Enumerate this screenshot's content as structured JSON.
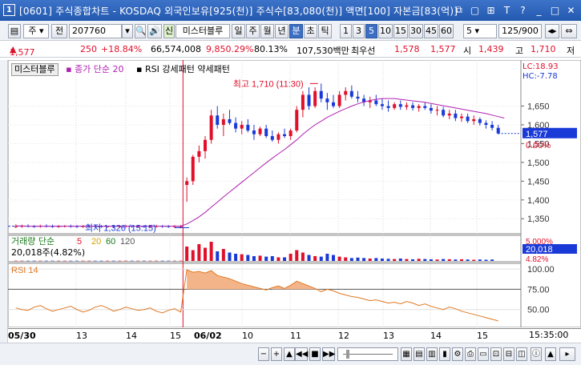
{
  "window": {
    "icon": "1",
    "title": "[0601] 주식종합차트 - KOSDAQ 외국인보유[925(천)] 주식수[83,080(천)] 액면[100] 자본금[83(억)]",
    "buttons": [
      "restore-icon",
      "copy-icon",
      "pin-icon",
      "font-icon",
      "help-icon",
      "minimize-icon",
      "maximize-icon",
      "close-icon"
    ],
    "button_glyphs": [
      "⧉",
      "▢",
      "⊞",
      "T",
      "?",
      "_",
      "□",
      "✕"
    ]
  },
  "toolbar": {
    "market": "주",
    "prefix": "전",
    "code": "207760",
    "name_label": "미스터블루",
    "name_prefix": "신",
    "periods": [
      "일",
      "주",
      "월",
      "년",
      "분",
      "초",
      "틱"
    ],
    "active_period": "분",
    "intervals": [
      "1",
      "3",
      "5",
      "10",
      "15",
      "30",
      "45",
      "60"
    ],
    "active_interval": "5",
    "count_value": "5",
    "range": "125/900"
  },
  "quote": {
    "price": "1,577",
    "change": "250",
    "change_pct": "+18.84%",
    "volume": "66,574,008",
    "volume_pct": "9,850.29%",
    "turnover_pct": "80.13%",
    "amount": "107,530백만",
    "best_ask_label": "최우선",
    "best_ask": "1,578",
    "best_bid": "1,577",
    "open_label": "시",
    "open": "1,439",
    "high_label": "고",
    "high": "1,710",
    "low_label": "저"
  },
  "legend": {
    "stock": "미스터블루",
    "ma": "종가 단순 20",
    "rsi_label": "RSI 강세패턴 약세패턴",
    "lc": "LC:18.93",
    "hc": "HC:-7.78"
  },
  "annotations": {
    "high": "최고 1,710 (11:30)",
    "low": "최저 1,326 (15:15)"
  },
  "volume_panel": {
    "label": "거래량 단순",
    "ma_values": [
      "5",
      "20",
      "60",
      "120"
    ],
    "value": "20,018주(4.82%)",
    "right_value": "20,018",
    "right_pct": "4.82%",
    "right_top": "5,000%"
  },
  "rsi_panel": {
    "label": "RSI 14"
  },
  "price_axis": {
    "ticks": [
      "1,650",
      "1,600",
      "1,550",
      "1,500",
      "1,450",
      "1,400",
      "1,350"
    ],
    "current": "1,577",
    "current_pct": "0.00%"
  },
  "rsi_axis": {
    "ticks": [
      "100.00",
      "75.00",
      "50.00"
    ]
  },
  "xaxis": {
    "labels": [
      "05/30",
      "13",
      "14",
      "15",
      "06/02",
      "10",
      "11",
      "12",
      "13",
      "14",
      "15"
    ],
    "bold": [
      "05/30",
      "06/02"
    ],
    "time": "15:35:00"
  },
  "colors": {
    "up": "#e0102a",
    "down": "#1a3ad8",
    "ma": "#b020b0",
    "rsi": "#e07820"
  },
  "chart_data": {
    "type": "candlestick",
    "ylim": [
      1310,
      1730
    ],
    "candles": [
      [
        1330,
        1335,
        1325,
        1330
      ],
      [
        1330,
        1334,
        1326,
        1331
      ],
      [
        1331,
        1335,
        1327,
        1330
      ],
      [
        1330,
        1333,
        1326,
        1329
      ],
      [
        1329,
        1334,
        1326,
        1331
      ],
      [
        1331,
        1335,
        1327,
        1330
      ],
      [
        1330,
        1334,
        1326,
        1329
      ],
      [
        1329,
        1333,
        1326,
        1330
      ],
      [
        1330,
        1333,
        1327,
        1331
      ],
      [
        1331,
        1334,
        1326,
        1330
      ],
      [
        1330,
        1333,
        1326,
        1329
      ],
      [
        1329,
        1333,
        1326,
        1330
      ],
      [
        1330,
        1334,
        1327,
        1331
      ],
      [
        1331,
        1334,
        1326,
        1330
      ],
      [
        1330,
        1333,
        1326,
        1328
      ],
      [
        1328,
        1332,
        1326,
        1330
      ],
      [
        1330,
        1333,
        1326,
        1329
      ],
      [
        1329,
        1333,
        1326,
        1330
      ],
      [
        1330,
        1334,
        1326,
        1331
      ],
      [
        1331,
        1333,
        1326,
        1329
      ],
      [
        1329,
        1333,
        1326,
        1330
      ],
      [
        1330,
        1333,
        1326,
        1329
      ],
      [
        1329,
        1332,
        1326,
        1330
      ],
      [
        1330,
        1334,
        1326,
        1331
      ],
      [
        1331,
        1333,
        1326,
        1330
      ],
      [
        1330,
        1333,
        1326,
        1329
      ],
      [
        1329,
        1333,
        1326,
        1330
      ],
      [
        1330,
        1333,
        1326,
        1330
      ],
      [
        1440,
        1460,
        1395,
        1450
      ],
      [
        1450,
        1520,
        1440,
        1515
      ],
      [
        1515,
        1545,
        1500,
        1530
      ],
      [
        1530,
        1570,
        1510,
        1560
      ],
      [
        1560,
        1640,
        1550,
        1625
      ],
      [
        1625,
        1650,
        1590,
        1600
      ],
      [
        1600,
        1630,
        1570,
        1615
      ],
      [
        1615,
        1640,
        1600,
        1605
      ],
      [
        1605,
        1620,
        1580,
        1590
      ],
      [
        1590,
        1610,
        1575,
        1600
      ],
      [
        1600,
        1615,
        1580,
        1585
      ],
      [
        1585,
        1600,
        1560,
        1575
      ],
      [
        1575,
        1595,
        1570,
        1590
      ],
      [
        1590,
        1600,
        1565,
        1570
      ],
      [
        1570,
        1585,
        1555,
        1560
      ],
      [
        1560,
        1580,
        1550,
        1575
      ],
      [
        1575,
        1590,
        1565,
        1570
      ],
      [
        1570,
        1590,
        1560,
        1585
      ],
      [
        1585,
        1650,
        1580,
        1640
      ],
      [
        1640,
        1690,
        1620,
        1680
      ],
      [
        1680,
        1700,
        1640,
        1650
      ],
      [
        1650,
        1700,
        1645,
        1690
      ],
      [
        1690,
        1710,
        1660,
        1670
      ],
      [
        1670,
        1685,
        1640,
        1660
      ],
      [
        1660,
        1680,
        1645,
        1650
      ],
      [
        1650,
        1690,
        1645,
        1680
      ],
      [
        1680,
        1700,
        1665,
        1690
      ],
      [
        1690,
        1705,
        1670,
        1675
      ],
      [
        1675,
        1690,
        1660,
        1670
      ],
      [
        1670,
        1680,
        1650,
        1660
      ],
      [
        1660,
        1675,
        1645,
        1665
      ],
      [
        1665,
        1680,
        1650,
        1655
      ],
      [
        1655,
        1670,
        1640,
        1650
      ],
      [
        1650,
        1665,
        1635,
        1645
      ],
      [
        1645,
        1660,
        1640,
        1655
      ],
      [
        1655,
        1665,
        1640,
        1648
      ],
      [
        1648,
        1660,
        1640,
        1652
      ],
      [
        1652,
        1660,
        1638,
        1645
      ],
      [
        1645,
        1655,
        1635,
        1650
      ],
      [
        1650,
        1660,
        1640,
        1645
      ],
      [
        1645,
        1655,
        1630,
        1638
      ],
      [
        1638,
        1650,
        1625,
        1640
      ],
      [
        1640,
        1648,
        1620,
        1625
      ],
      [
        1625,
        1640,
        1615,
        1630
      ],
      [
        1630,
        1640,
        1610,
        1618
      ],
      [
        1618,
        1630,
        1608,
        1622
      ],
      [
        1622,
        1630,
        1605,
        1610
      ],
      [
        1610,
        1625,
        1600,
        1615
      ],
      [
        1615,
        1620,
        1598,
        1605
      ],
      [
        1605,
        1612,
        1590,
        1600
      ],
      [
        1600,
        1610,
        1585,
        1592
      ],
      [
        1592,
        1600,
        1575,
        1577
      ]
    ],
    "ma20": [
      1331,
      1331,
      1330,
      1330,
      1330,
      1330,
      1330,
      1330,
      1330,
      1330,
      1330,
      1330,
      1330,
      1330,
      1330,
      1330,
      1330,
      1330,
      1330,
      1330,
      1330,
      1330,
      1330,
      1330,
      1330,
      1330,
      1330,
      1330,
      1336,
      1345,
      1355,
      1367,
      1381,
      1394,
      1408,
      1421,
      1434,
      1447,
      1460,
      1473,
      1486,
      1499,
      1511,
      1523,
      1534,
      1547,
      1560,
      1575,
      1588,
      1600,
      1610,
      1620,
      1628,
      1636,
      1643,
      1650,
      1656,
      1661,
      1665,
      1668,
      1670,
      1670,
      1670,
      1668,
      1666,
      1664,
      1662,
      1660,
      1657,
      1654,
      1651,
      1648,
      1645,
      1642,
      1639,
      1636,
      1633,
      1630,
      1626,
      1622,
      1618
    ],
    "volume": [
      1,
      1,
      1,
      1,
      1,
      1,
      1,
      1,
      1,
      1,
      1,
      1,
      1,
      1,
      1,
      1,
      1,
      1,
      1,
      1,
      1,
      1,
      1,
      1,
      1,
      1,
      1,
      1,
      60,
      45,
      70,
      55,
      80,
      40,
      50,
      35,
      30,
      28,
      25,
      20,
      22,
      18,
      20,
      15,
      15,
      30,
      45,
      35,
      25,
      20,
      18,
      30,
      25,
      18,
      15,
      12,
      14,
      12,
      10,
      12,
      10,
      9,
      8,
      10,
      8,
      7,
      9,
      8,
      7,
      6,
      8,
      7,
      6,
      7,
      6,
      5,
      6,
      5,
      6
    ],
    "rsi": [
      52,
      50,
      49,
      53,
      55,
      51,
      48,
      50,
      52,
      54,
      50,
      47,
      49,
      53,
      55,
      52,
      48,
      50,
      53,
      51,
      49,
      50,
      52,
      48,
      46,
      49,
      51,
      47,
      99,
      96,
      97,
      95,
      98,
      92,
      90,
      88,
      85,
      82,
      80,
      78,
      76,
      74,
      77,
      79,
      76,
      80,
      85,
      82,
      79,
      76,
      72,
      75,
      73,
      70,
      68,
      66,
      65,
      63,
      61,
      62,
      60,
      58,
      59,
      57,
      60,
      58,
      55,
      57,
      54,
      52,
      50,
      53,
      51,
      48,
      46,
      44,
      42,
      40,
      38,
      36
    ]
  }
}
